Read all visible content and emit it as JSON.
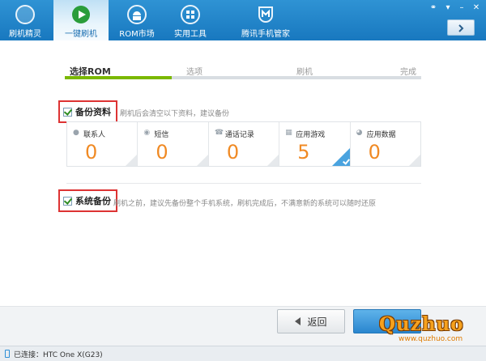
{
  "nav": {
    "tabs": [
      {
        "label": "刷机精灵"
      },
      {
        "label": "一键刷机"
      },
      {
        "label": "ROM市场"
      },
      {
        "label": "实用工具"
      },
      {
        "label": "腾讯手机管家"
      }
    ]
  },
  "steps": [
    "选择ROM",
    "选项",
    "刷机",
    "完成"
  ],
  "progress_fraction": 0.3,
  "backup_data": {
    "title": "备份资料",
    "desc": "刷机后会清空以下资料，建议备份",
    "cards": [
      {
        "label": "联系人",
        "value": "0",
        "icon": "person-icon"
      },
      {
        "label": "短信",
        "value": "0",
        "icon": "message-icon"
      },
      {
        "label": "通话记录",
        "value": "0",
        "icon": "phone-icon"
      },
      {
        "label": "应用游戏",
        "value": "5",
        "icon": "app-icon"
      },
      {
        "label": "应用数据",
        "value": "0",
        "icon": "pie-icon"
      }
    ]
  },
  "system_backup": {
    "title": "系统备份",
    "desc": "刷机之前，建议先备份整个手机系统，刷机完成后，不满意新的系统可以随时还原"
  },
  "buttons": {
    "back": "返回"
  },
  "watermark": {
    "brand": "Quzhuo",
    "url": "www.quzhuo.com"
  },
  "status": {
    "connection": "已连接：HTC One X(G23)"
  },
  "colors": {
    "header": "#1f82c8",
    "accent_green": "#7ab800",
    "number_orange": "#f08a24",
    "highlight_red": "#dd3333"
  }
}
